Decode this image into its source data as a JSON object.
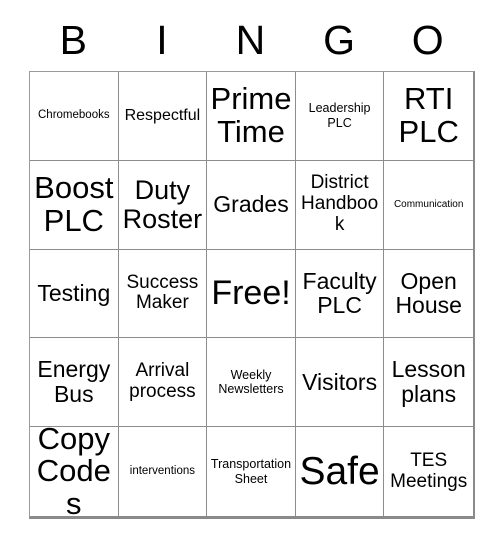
{
  "card": {
    "title_letters": [
      "B",
      "I",
      "N",
      "G",
      "O"
    ],
    "rows": [
      [
        {
          "text": "Chromebooks",
          "size": "sz-s"
        },
        {
          "text": "Respectful",
          "size": "sz-m"
        },
        {
          "text": "Prime Time",
          "size": "sz-xxl"
        },
        {
          "text": "Leadership PLC",
          "size": "sz-sm"
        },
        {
          "text": "RTI PLC",
          "size": "sz-xxl"
        }
      ],
      [
        {
          "text": "Boost PLC",
          "size": "sz-xxl"
        },
        {
          "text": "Duty Roster",
          "size": "sz-xl"
        },
        {
          "text": "Grades",
          "size": "sz-l"
        },
        {
          "text": "District Handbook",
          "size": "sz-ml"
        },
        {
          "text": "Communication",
          "size": "sz-xs"
        }
      ],
      [
        {
          "text": "Testing",
          "size": "sz-l"
        },
        {
          "text": "Success Maker",
          "size": "sz-ml"
        },
        {
          "text": "Free!",
          "size": "sz-huge"
        },
        {
          "text": "Faculty PLC",
          "size": "sz-l"
        },
        {
          "text": "Open House",
          "size": "sz-l"
        }
      ],
      [
        {
          "text": "Energy Bus",
          "size": "sz-l"
        },
        {
          "text": "Arrival process",
          "size": "sz-ml"
        },
        {
          "text": "Weekly Newsletters",
          "size": "sz-sm"
        },
        {
          "text": "Visitors",
          "size": "sz-l"
        },
        {
          "text": "Lesson plans",
          "size": "sz-l"
        }
      ],
      [
        {
          "text": "Copy Codes",
          "size": "sz-xxl"
        },
        {
          "text": "interventions",
          "size": "sz-s"
        },
        {
          "text": "Transportation Sheet",
          "size": "sz-sm"
        },
        {
          "text": "Safe",
          "size": "sz-mega"
        },
        {
          "text": "TES Meetings",
          "size": "sz-ml"
        }
      ]
    ],
    "colors": {
      "background": "#ffffff",
      "text": "#000000",
      "grid_line": "#8d8d8d",
      "grid_shadow": "#8a8a8a"
    }
  }
}
